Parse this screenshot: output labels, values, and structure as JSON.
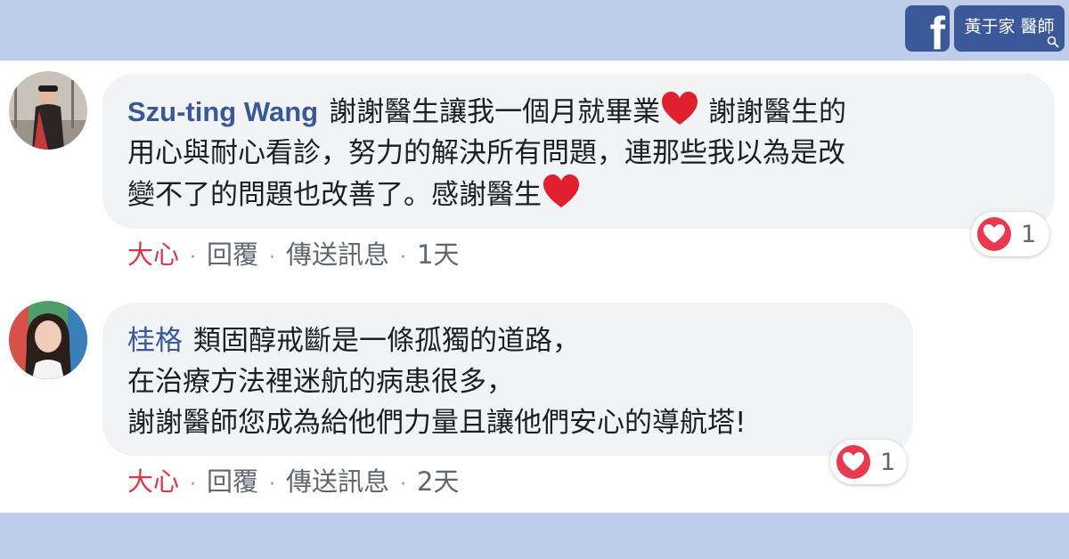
{
  "brand": {
    "facebook_logo_letter": "f",
    "doctor_name": "黃于家 醫師",
    "colors": {
      "band": "#bfcde9",
      "facebook_blue": "#3b5998",
      "link": "#385898",
      "love_red": "#d9394a"
    }
  },
  "comments": [
    {
      "author": "Szu-ting Wang",
      "lines": [
        "謝謝醫生讓我一個月就畢業",
        " 謝謝醫生的",
        "用心與耐心看診，努力的解決所有問題，連那些我以為是改",
        "變不了的問題也改善了。感謝醫生"
      ],
      "actions": {
        "love": "大心",
        "reply": "回覆",
        "message": "傳送訊息",
        "time": "1天"
      },
      "reaction_icon": "love-reaction-icon",
      "reaction_count": "1"
    },
    {
      "author": "桂格",
      "lines": [
        "類固醇戒斷是一條孤獨的道路，",
        "在治療方法裡迷航的病患很多，",
        "謝謝醫師您成為給他們力量且讓他們安心的導航塔!"
      ],
      "actions": {
        "love": "大心",
        "reply": "回覆",
        "message": "傳送訊息",
        "time": "2天"
      },
      "reaction_icon": "love-reaction-icon",
      "reaction_count": "1"
    }
  ]
}
